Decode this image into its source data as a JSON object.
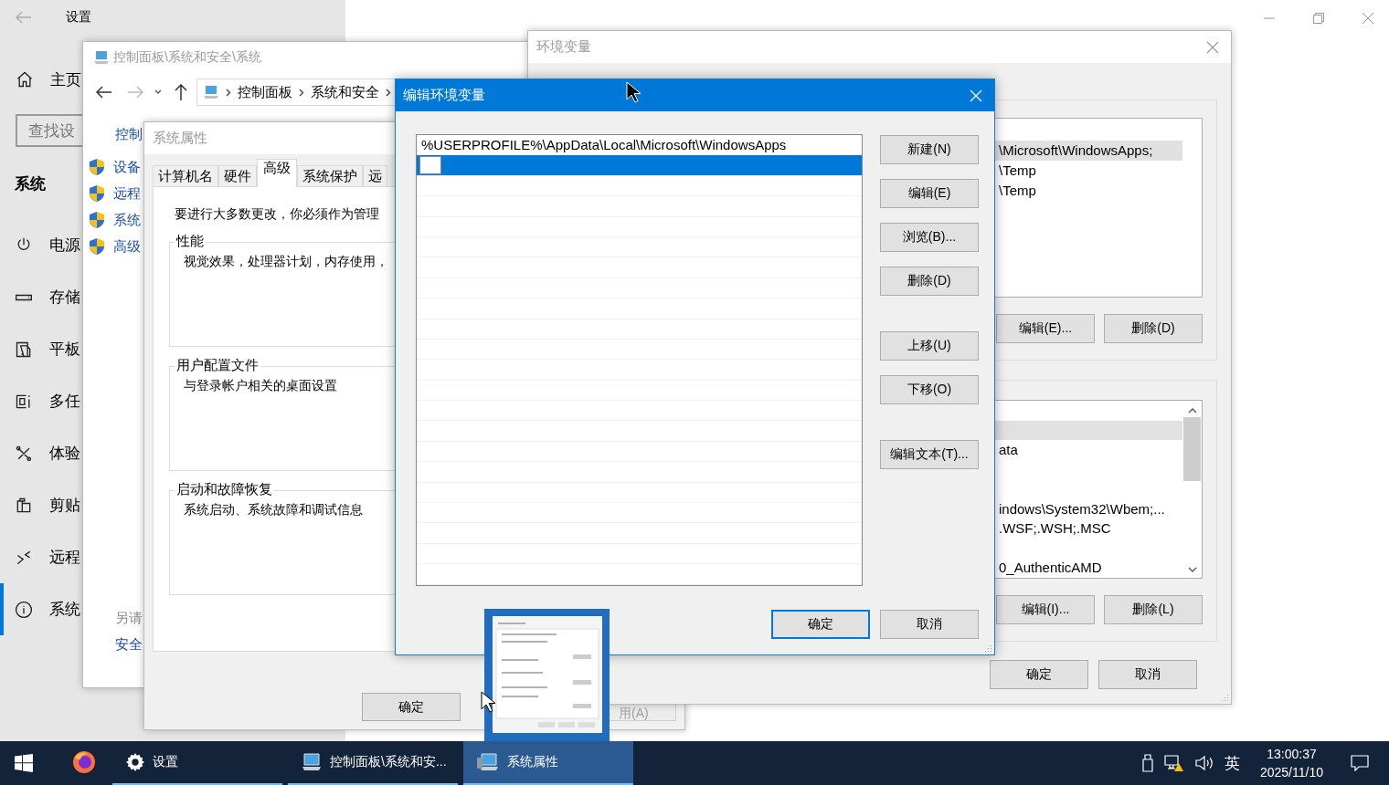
{
  "settings": {
    "title": "设置",
    "home": "主页",
    "search": {
      "placeholder": "查找设"
    },
    "section": "系统",
    "nav": [
      {
        "kind": "power",
        "label": "电源",
        "selected": false
      },
      {
        "kind": "storage",
        "label": "存储",
        "selected": false
      },
      {
        "kind": "tablet",
        "label": "平板",
        "selected": false
      },
      {
        "kind": "multitask",
        "label": "多任",
        "selected": false
      },
      {
        "kind": "experience",
        "label": "体验",
        "selected": false
      },
      {
        "kind": "clipboard",
        "label": "剪贴",
        "selected": false
      },
      {
        "kind": "remote",
        "label": "远程",
        "selected": false
      },
      {
        "kind": "about",
        "label": "系统",
        "selected": true
      }
    ]
  },
  "control_panel": {
    "title": "控制面板\\系统和安全\\系统",
    "breadcrumb": [
      "控制面板",
      "系统和安全"
    ],
    "home_link": "控制",
    "tasks": [
      "设备",
      "远程",
      "系统",
      "高级"
    ],
    "see_also": "另请",
    "see_also_links": [
      "安全"
    ]
  },
  "system_properties": {
    "title": "系统属性",
    "tabs": [
      {
        "label": "计算机名",
        "selected": false
      },
      {
        "label": "硬件",
        "selected": false
      },
      {
        "label": "高级",
        "selected": true
      },
      {
        "label": "系统保护",
        "selected": false
      },
      {
        "label": "远",
        "selected": false
      }
    ],
    "notice": "要进行大多数更改，你必须作为管理",
    "groups": [
      {
        "title": "性能",
        "text": "视觉效果，处理器计划，内存使用，"
      },
      {
        "title": "用户配置文件",
        "text": "与登录帐户相关的桌面设置"
      },
      {
        "title": "启动和故障恢复",
        "text": "系统启动、系统故障和调试信息"
      }
    ],
    "ok_button": {
      "label": "确定",
      "disabled": false
    },
    "apply_button": {
      "label": "用(A)",
      "disabled": true
    }
  },
  "environment_variables": {
    "title": "环境变量",
    "user_rows": [
      {
        "selected": false
      },
      {
        "text": "\\Microsoft\\WindowsApps;",
        "selected": true
      },
      {
        "text": "\\Temp",
        "selected": false
      },
      {
        "text": "\\Temp",
        "selected": false
      }
    ],
    "user_buttons": [
      "编辑(E)...",
      "删除(D)"
    ],
    "system_rows": [
      {
        "selected": false
      },
      {
        "selected": true
      },
      {
        "text": "ata",
        "selected": false
      },
      {
        "selected": false
      },
      {
        "selected": false
      },
      {
        "text": "indows\\System32\\Wbem;...",
        "selected": false
      },
      {
        "text": ".WSF;.WSH;.MSC",
        "selected": false
      },
      {
        "selected": false
      },
      {
        "text": "0_AuthenticAMD",
        "selected": false
      }
    ],
    "system_buttons": [
      "编辑(I)...",
      "删除(L)"
    ],
    "buttons": [
      "确定",
      "取消"
    ]
  },
  "edit_dialog": {
    "title": "编辑环境变量",
    "entries": [
      {
        "text": "%USERPROFILE%\\AppData\\Local\\Microsoft\\WindowsApps",
        "selected": false,
        "editing": false
      },
      {
        "selected": true,
        "editing": true
      }
    ],
    "side_button_groups": [
      [
        "新建(N)",
        "编辑(E)",
        "浏览(B)...",
        "删除(D)"
      ],
      [
        "上移(U)",
        "下移(O)"
      ],
      [
        "编辑文本(T)..."
      ]
    ],
    "buttons": [
      {
        "label": "确定",
        "default": true
      },
      {
        "label": "取消",
        "default": false
      }
    ]
  },
  "taskbar": {
    "apps": [
      {
        "kind": "firefox",
        "running": false,
        "selected": false
      },
      {
        "kind": "settings",
        "label": "设置",
        "running": true,
        "selected": false
      },
      {
        "kind": "control_panel",
        "label": "控制面板\\系统和安...",
        "running": true,
        "selected": false
      },
      {
        "kind": "system_properties",
        "label": "系统属性",
        "running": true,
        "selected": true
      }
    ],
    "ime": "英",
    "time": "13:00:37",
    "date": "2025/11/10"
  }
}
